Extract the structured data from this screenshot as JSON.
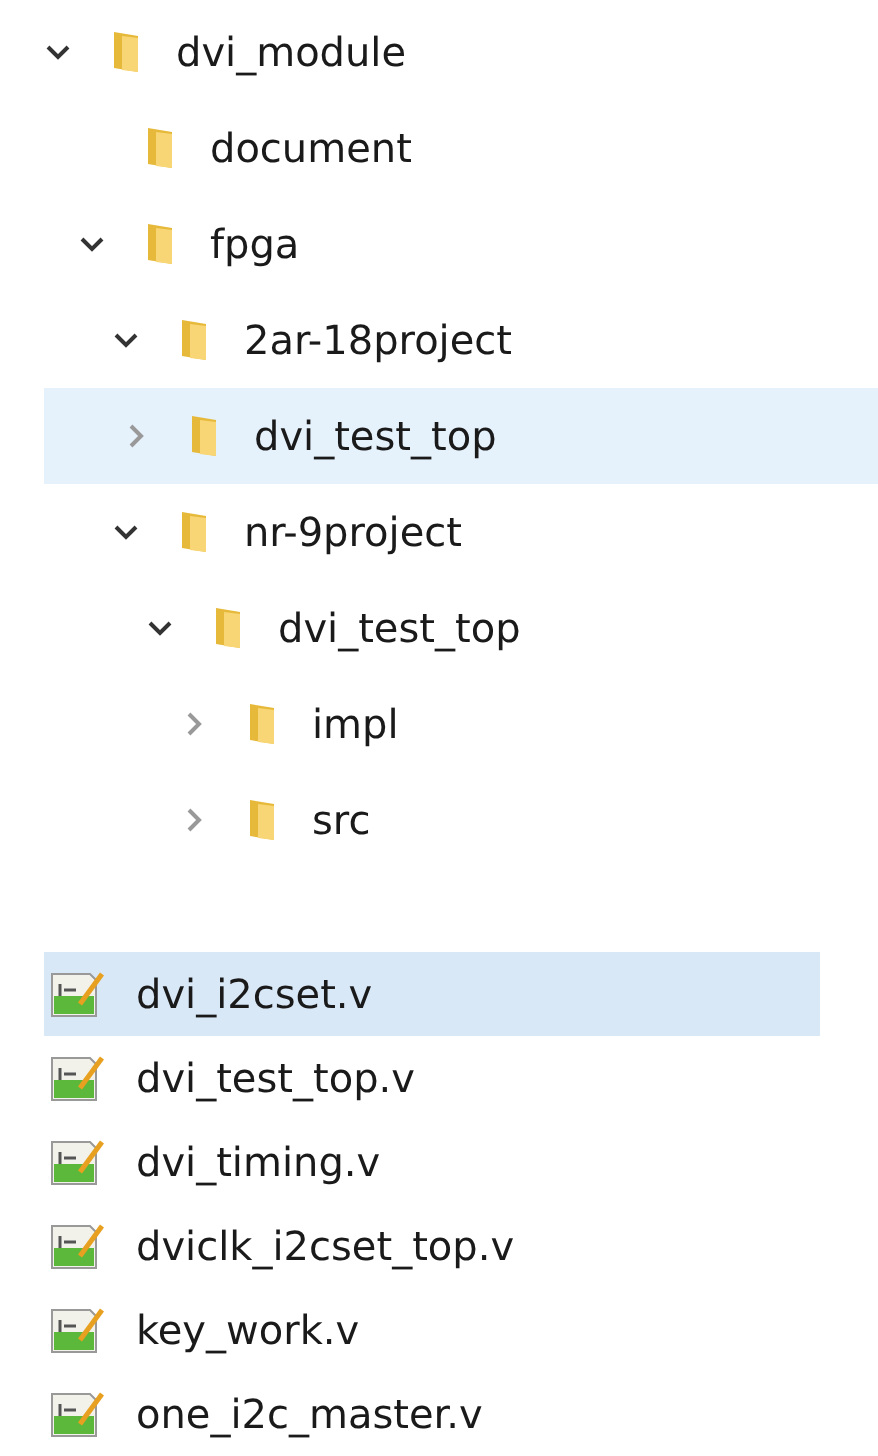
{
  "tree": [
    {
      "label": "dvi_module",
      "expanded": true,
      "selected": false,
      "children": [
        {
          "label": "document",
          "selected": false
        },
        {
          "label": "fpga",
          "expanded": true,
          "selected": false,
          "children": [
            {
              "label": "2ar-18project",
              "expanded": true,
              "selected": false,
              "children": [
                {
                  "label": "dvi_test_top",
                  "expanded": false,
                  "selected": true
                }
              ]
            },
            {
              "label": "nr-9project",
              "expanded": true,
              "selected": false,
              "children": [
                {
                  "label": "dvi_test_top",
                  "expanded": true,
                  "selected": false,
                  "children": [
                    {
                      "label": "impl",
                      "expanded": false,
                      "selected": false
                    },
                    {
                      "label": "src",
                      "expanded": false,
                      "selected": false
                    }
                  ]
                }
              ]
            }
          ]
        }
      ]
    }
  ],
  "files": [
    {
      "label": "dvi_i2cset.v",
      "selected": true
    },
    {
      "label": "dvi_test_top.v",
      "selected": false
    },
    {
      "label": "dvi_timing.v",
      "selected": false
    },
    {
      "label": "dviclk_i2cset_top.v",
      "selected": false
    },
    {
      "label": "key_work.v",
      "selected": false
    },
    {
      "label": "one_i2c_master.v",
      "selected": false
    }
  ]
}
